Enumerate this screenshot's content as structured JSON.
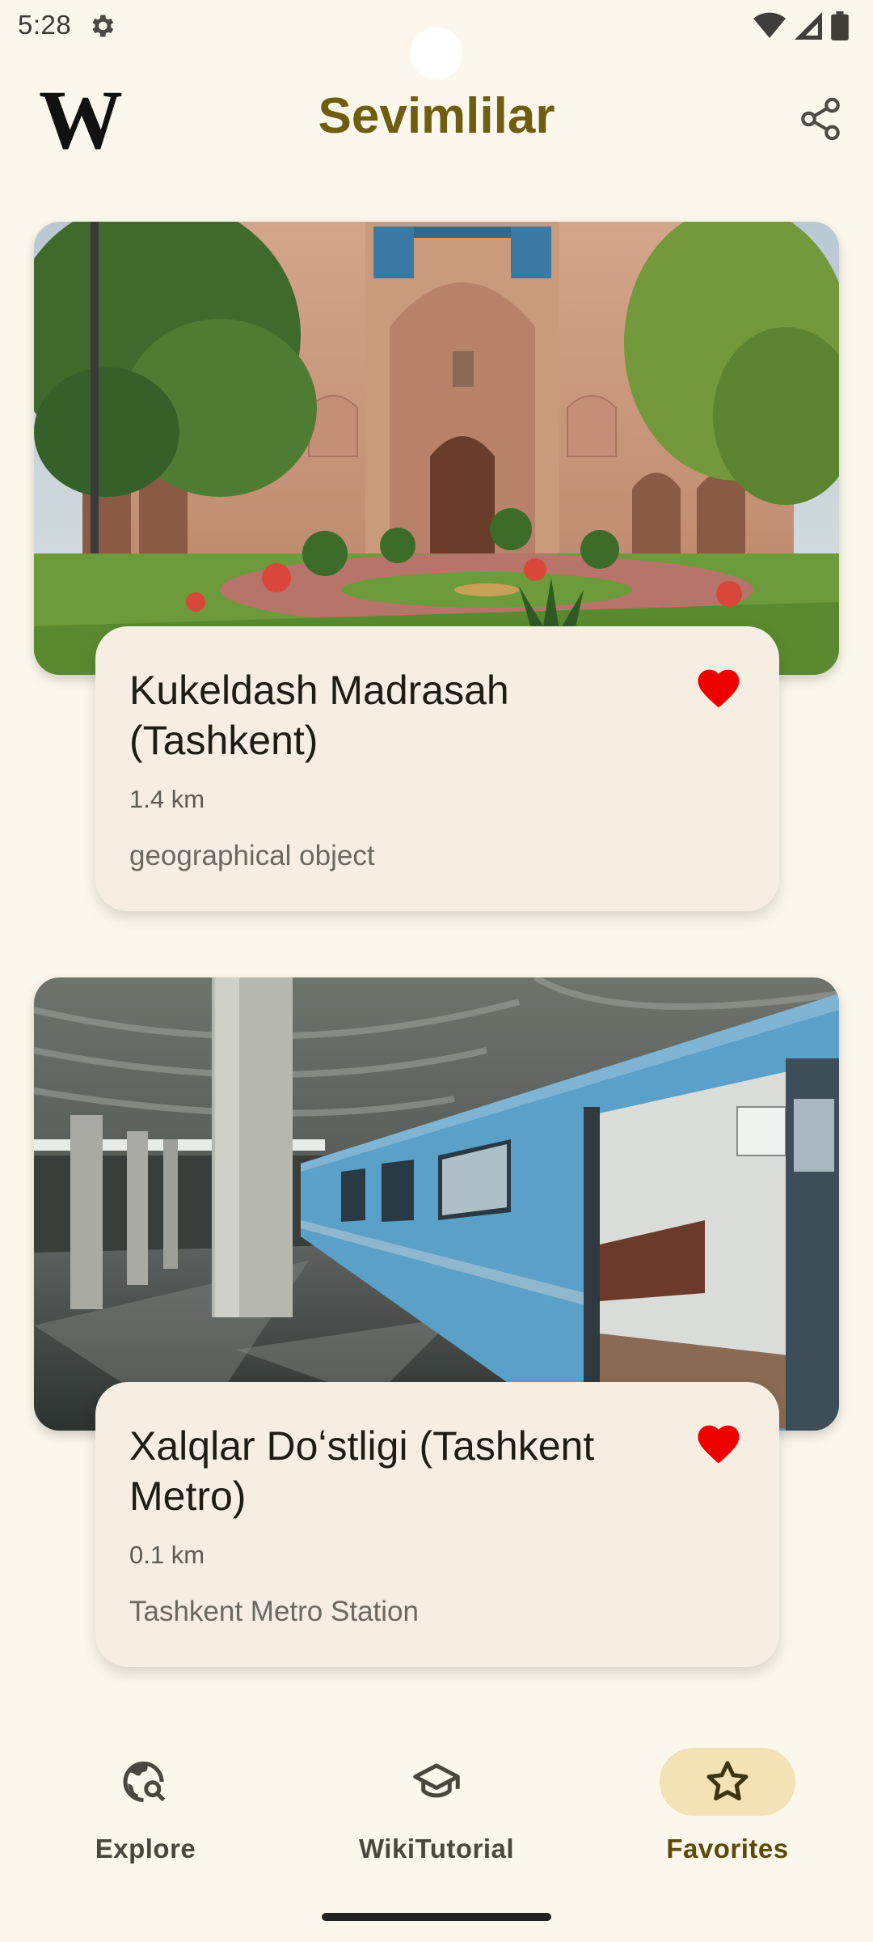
{
  "status_bar": {
    "time": "5:28",
    "icons": [
      "settings-icon",
      "wifi-icon",
      "signal-icon",
      "battery-icon"
    ]
  },
  "app_bar": {
    "logo_text": "W",
    "title": "Sevimlilar",
    "share_icon": "share-icon"
  },
  "favorites": [
    {
      "title": "Kukeldash Madrasah (Tashkent)",
      "distance": "1.4 km",
      "description": "geographical object",
      "favorited": true
    },
    {
      "title": "Xalqlar Doʻstligi (Tashkent Metro)",
      "distance": "0.1 km",
      "description": "Tashkent Metro Station",
      "favorited": true
    }
  ],
  "bottom_nav": {
    "items": [
      {
        "label": "Explore",
        "icon": "explore-icon",
        "active": false
      },
      {
        "label": "WikiTutorial",
        "icon": "graduation-cap-icon",
        "active": false
      },
      {
        "label": "Favorites",
        "icon": "star-icon",
        "active": true
      }
    ]
  },
  "colors": {
    "background": "#FCF7EC",
    "title": "#6f5d10",
    "heart": "#EE0000",
    "active_pill": "#F2E2B5"
  }
}
